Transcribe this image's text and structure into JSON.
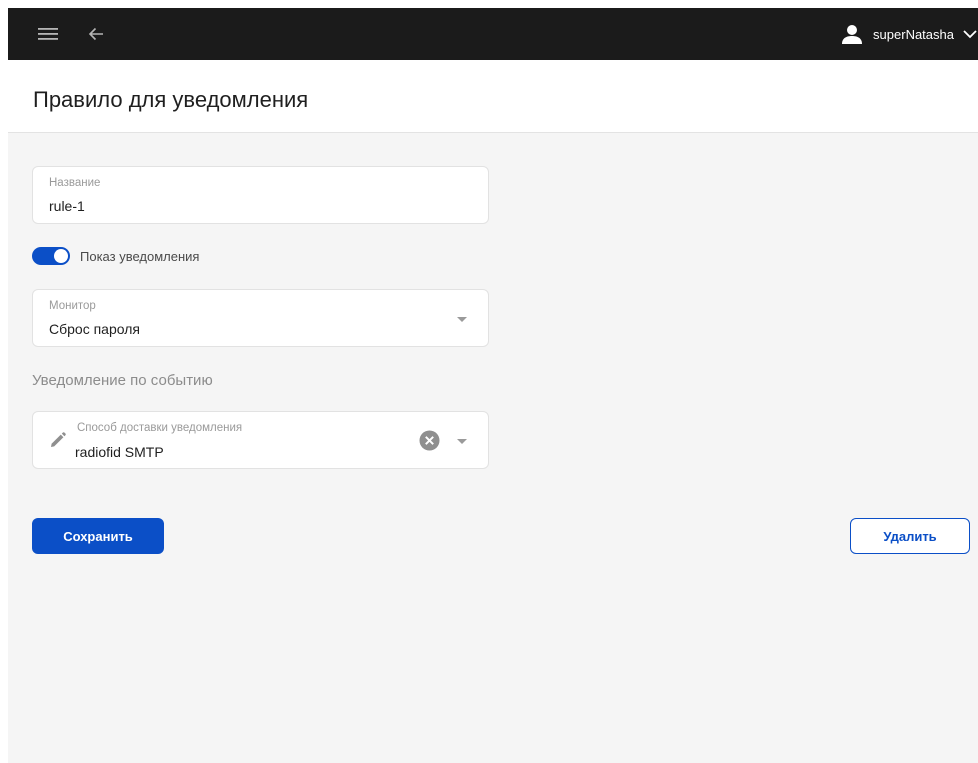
{
  "topbar": {
    "username": "superNatasha",
    "menu_icon": "hamburger-menu-icon",
    "back_icon": "arrow-left-icon",
    "user_icon": "user-avatar-icon",
    "dropdown_icon": "chevron-down-icon"
  },
  "page": {
    "title": "Правило для уведомления"
  },
  "form": {
    "name_field": {
      "label": "Название",
      "value": "rule-1"
    },
    "show_notification": {
      "label": "Показ уведомления",
      "enabled": true
    },
    "monitor_field": {
      "label": "Монитор",
      "value": "Сброс пароля"
    },
    "event_section_title": "Уведомление по событию",
    "delivery_field": {
      "label": "Способ доставки уведомления",
      "value": "radiofid SMTP"
    }
  },
  "actions": {
    "save_label": "Сохранить",
    "delete_label": "Удалить"
  },
  "colors": {
    "accent": "#0b4fc7",
    "topbar": "#1b1b1b",
    "background": "#f5f5f5"
  }
}
